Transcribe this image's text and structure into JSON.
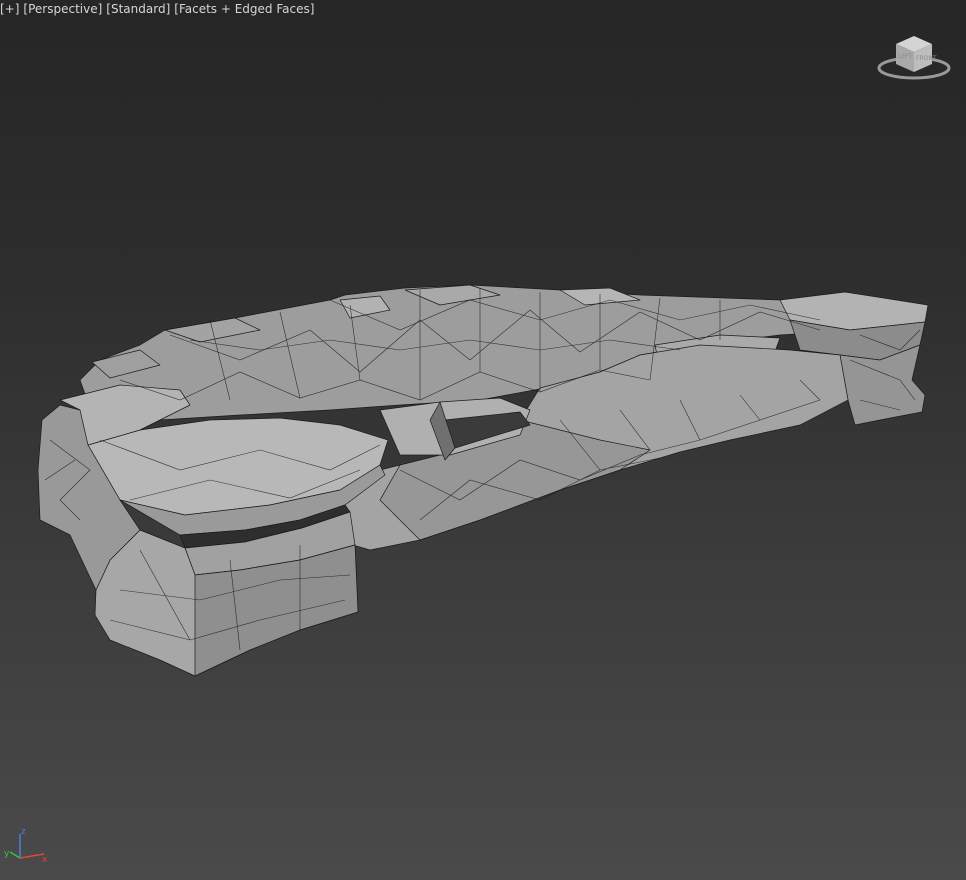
{
  "viewport_menu": {
    "plus": "[+]",
    "view": "[Perspective]",
    "shading": "[Standard]",
    "display": "[Facets + Edged Faces]"
  },
  "viewcube": {
    "left_face": "LEFT",
    "front_face": "FRONT",
    "icon": "viewcube-icon"
  },
  "axis_tripod": {
    "x_label": "x",
    "y_label": "y",
    "z_label": "z",
    "x_color": "#e0483a",
    "y_color": "#3fbf3f",
    "z_color": "#4a7fe0"
  },
  "colors": {
    "background_top": "#262626",
    "background_bottom": "#4a4a4a",
    "mesh_fill": "#a8a8a8",
    "wire": "#1a1a1a"
  }
}
